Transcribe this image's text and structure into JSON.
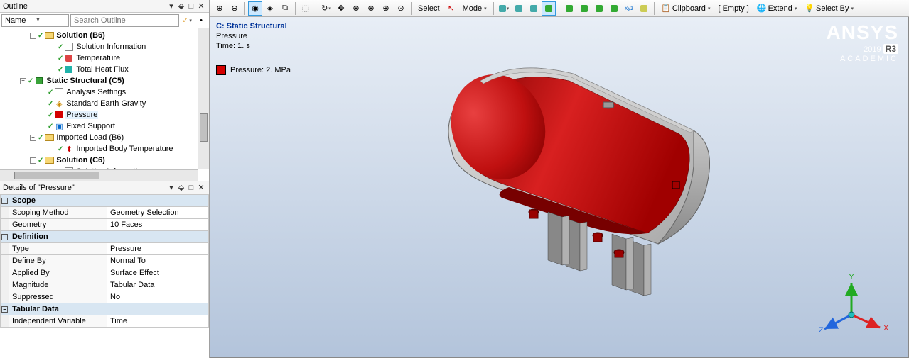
{
  "outline": {
    "title": "Outline",
    "filter_name": "Name",
    "search_placeholder": "Search Outline",
    "tree": [
      {
        "indent": 3,
        "expand": "-",
        "chk": true,
        "bold": true,
        "icon": "folder",
        "label": "Solution (B6)"
      },
      {
        "indent": 5,
        "chk": true,
        "icon": "doc",
        "label": "Solution Information"
      },
      {
        "indent": 5,
        "chk": true,
        "icon": "temp",
        "label": "Temperature"
      },
      {
        "indent": 5,
        "chk": true,
        "icon": "flux",
        "label": "Total Heat Flux"
      },
      {
        "indent": 2,
        "expand": "-",
        "chk": true,
        "bold": true,
        "icon": "struct",
        "label": "Static Structural (C5)"
      },
      {
        "indent": 4,
        "chk": true,
        "icon": "doc",
        "label": "Analysis Settings"
      },
      {
        "indent": 4,
        "chk": true,
        "icon": "grav",
        "label": "Standard Earth Gravity"
      },
      {
        "indent": 4,
        "chk": true,
        "icon": "press",
        "label": "Pressure",
        "sel": true
      },
      {
        "indent": 4,
        "chk": true,
        "icon": "supp",
        "label": "Fixed Support"
      },
      {
        "indent": 3,
        "expand": "-",
        "chk": true,
        "icon": "folder",
        "label": "Imported Load (B6)"
      },
      {
        "indent": 5,
        "chk": true,
        "icon": "imp",
        "label": "Imported Body Temperature"
      },
      {
        "indent": 3,
        "expand": "-",
        "chk": true,
        "bold": true,
        "icon": "folder",
        "label": "Solution (C6)"
      },
      {
        "indent": 5,
        "chk": true,
        "icon": "doc",
        "label": "Solution Information"
      }
    ]
  },
  "details": {
    "title": "Details of \"Pressure\"",
    "groups": [
      {
        "name": "Scope",
        "rows": [
          {
            "k": "Scoping Method",
            "v": "Geometry Selection"
          },
          {
            "k": "Geometry",
            "v": "10 Faces"
          }
        ]
      },
      {
        "name": "Definition",
        "rows": [
          {
            "k": "Type",
            "v": "Pressure"
          },
          {
            "k": "Define By",
            "v": "Normal To"
          },
          {
            "k": "Applied By",
            "v": "Surface Effect"
          },
          {
            "k": "Magnitude",
            "v": "Tabular Data"
          },
          {
            "k": "Suppressed",
            "v": "No"
          }
        ]
      },
      {
        "name": "Tabular Data",
        "rows": [
          {
            "k": "Independent Variable",
            "v": "Time"
          }
        ]
      }
    ]
  },
  "toolbar": {
    "select": "Select",
    "mode": "Mode",
    "clipboard": "Clipboard",
    "empty": "[ Empty ]",
    "extend": "Extend",
    "selectby": "Select By"
  },
  "viewport": {
    "title": "C: Static Structural",
    "subtitle": "Pressure",
    "time": "Time: 1. s",
    "legend": "Pressure: 2. MPa",
    "brand1": "ANSYS",
    "brand2a": "2019 ",
    "brand2b": "R3",
    "brand3": "ACADEMIC",
    "axes": {
      "x": "X",
      "y": "Y",
      "z": "Z"
    }
  }
}
